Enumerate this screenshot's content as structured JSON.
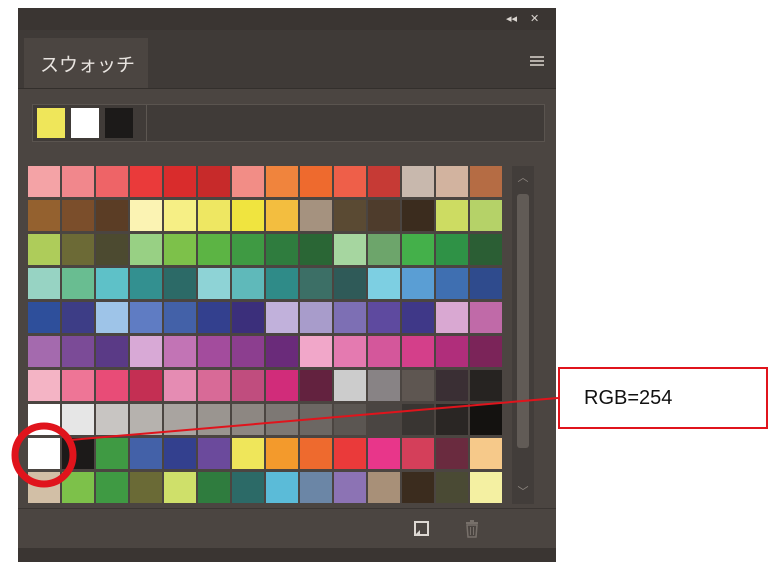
{
  "panel": {
    "tab_title": "スウォッチ",
    "icons": {
      "collapse": "double-chevron-left-icon",
      "close": "close-icon",
      "menu": "menu-icon",
      "new_swatch": "new-swatch-icon",
      "delete": "trash-icon",
      "scroll_up": "chevron-up-icon",
      "scroll_down": "chevron-down-icon"
    },
    "recent_swatches": [
      "#efe65a",
      "#ffffff",
      "#1c1a19"
    ],
    "swatches": [
      [
        "#f4a3a6",
        "#f1878c",
        "#ee6467",
        "#ea3a3a",
        "#d92c2c",
        "#c72a2a",
        "#f28d86",
        "#f0843d",
        "#ee6a2e",
        "#ee5f49",
        "#c63a35",
        "#c8b8ad",
        "#d2b39f",
        "#b56c44"
      ],
      [
        "#94612f",
        "#7b4e2b",
        "#5b3d25",
        "#fbf3b3",
        "#f6ef85",
        "#eee762",
        "#f0e43f",
        "#f3be3f",
        "#a5927f",
        "#5a4a33",
        "#4e3c2c",
        "#3b2c1e",
        "#cddc62",
        "#b5d268"
      ],
      [
        "#aecc5a",
        "#6c6a36",
        "#4c4a30",
        "#98d084",
        "#7dc14a",
        "#5cb444",
        "#3f9a43",
        "#2f7c3e",
        "#2a6635",
        "#a6d6a0",
        "#6da56b",
        "#44b04a",
        "#2f9246",
        "#2b5e34"
      ],
      [
        "#97d3c3",
        "#69bd91",
        "#5ec1c8",
        "#339090",
        "#2c6a67",
        "#8ed3d6",
        "#5fb9ba",
        "#2f8b88",
        "#3c6f66",
        "#2f5a58",
        "#7dcfe2",
        "#5a9ed4",
        "#3f6fb1",
        "#2f4b8d"
      ],
      [
        "#2e4f9b",
        "#3d3d86",
        "#9ec4e8",
        "#5f7cc3",
        "#4361a8",
        "#33408e",
        "#3b2f7b",
        "#c1b1db",
        "#a89ccb",
        "#7d6fb4",
        "#5e4a9f",
        "#3f3888",
        "#d9a8d2",
        "#c06aa8"
      ],
      [
        "#a46aae",
        "#7b4b97",
        "#5a3a86",
        "#d8a9d6",
        "#c274b5",
        "#a34c9d",
        "#8c3e8f",
        "#6a2b7a",
        "#f1a7c9",
        "#e47ab0",
        "#d4579b",
        "#d43f8a",
        "#b02e7b",
        "#7b2459"
      ],
      [
        "#f4b4c5",
        "#ee7596",
        "#e84c77",
        "#c42f53",
        "#e58cb3",
        "#d86a97",
        "#c04d7e",
        "#d12c7a",
        "#63223f",
        "#cccccc",
        "#888385",
        "#5e5651",
        "#3a2f34",
        "#262321"
      ],
      [
        "#ffffff",
        "#e6e6e6",
        "#c8c5c2",
        "#b6b2ae",
        "#a9a4a0",
        "#9a9590",
        "#8d8782",
        "#7d7874",
        "#6c6763",
        "#5b5652",
        "#4a4542",
        "#393532",
        "#2a2624",
        "#141210"
      ],
      [
        "#ffffff",
        "#1c1a19",
        "#3f9a43",
        "#4361a8",
        "#33408e",
        "#6b4a9c",
        "#efe65a",
        "#f39a2c",
        "#ee6a2e",
        "#ea3a3a",
        "#e8368a",
        "#d43f5a",
        "#6a2b3f",
        "#f6c98a"
      ],
      [
        "#d2bfa6",
        "#7dc14a",
        "#3f9a43",
        "#6a6a36",
        "#cfe06a",
        "#2f7c3e",
        "#2c6a67",
        "#5bbbd8",
        "#6b86a6",
        "#8c73b4",
        "#a89078",
        "#3b2c1e",
        "#4a4a34",
        "#f4f0a2"
      ]
    ]
  },
  "annotation": {
    "label": "RGB=254",
    "color": "#e0141c"
  }
}
